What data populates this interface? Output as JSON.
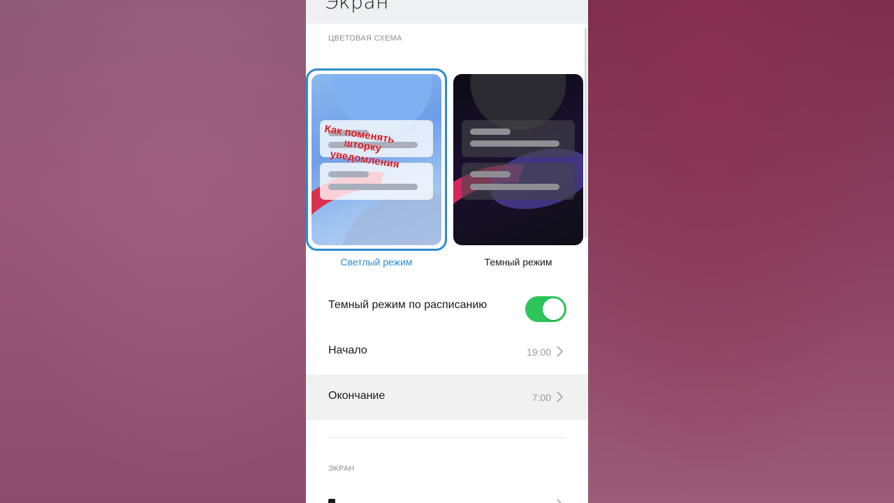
{
  "header": {
    "title": "Экран"
  },
  "color_scheme": {
    "section_label": "ЦВЕТОВАЯ СХЕМА",
    "light": {
      "label": "Светлый режим",
      "selected": true
    },
    "dark": {
      "label": "Темный режим",
      "selected": false
    },
    "overlay_text": [
      "Как поменять",
      "шторку",
      "уведомления"
    ]
  },
  "settings": {
    "scheduled_dark": {
      "label": "Темный режим по расписанию",
      "enabled": true
    },
    "start": {
      "label": "Начало",
      "value": "19:00"
    },
    "end": {
      "label": "Окончание",
      "value": "7:00"
    }
  },
  "screen_section": {
    "label": "ЭКРАН"
  },
  "colors": {
    "accent": "#2b8ccf",
    "toggle_on": "#2bc55a",
    "overlay_text": "#d81b23"
  },
  "icons": {
    "row_chevron": "chevron-right-icon"
  }
}
